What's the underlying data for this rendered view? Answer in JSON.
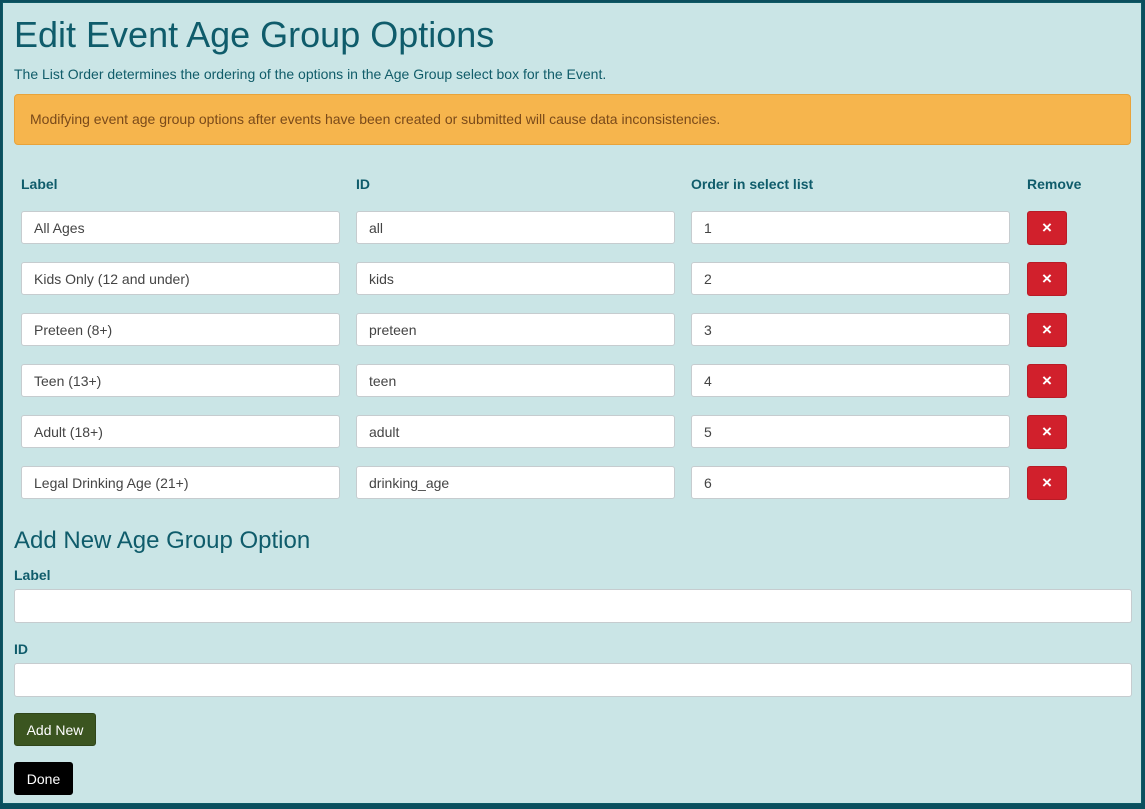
{
  "page": {
    "title": "Edit Event Age Group Options",
    "description": "The List Order determines the ordering of the options in the Age Group select box for the Event.",
    "alert": "Modifying event age group options after events have been created or submitted will cause data inconsistencies."
  },
  "table": {
    "headers": [
      "Label",
      "ID",
      "Order in select list",
      "Remove"
    ],
    "rows": [
      {
        "label": "All Ages",
        "id": "all",
        "order": "1"
      },
      {
        "label": "Kids Only (12 and under)",
        "id": "kids",
        "order": "2"
      },
      {
        "label": "Preteen (8+)",
        "id": "preteen",
        "order": "3"
      },
      {
        "label": "Teen (13+)",
        "id": "teen",
        "order": "4"
      },
      {
        "label": "Adult (18+)",
        "id": "adult",
        "order": "5"
      },
      {
        "label": "Legal Drinking Age (21+)",
        "id": "drinking_age",
        "order": "6"
      }
    ],
    "remove_icon": "×"
  },
  "add_new": {
    "title": "Add New Age Group Option",
    "label_label": "Label",
    "label_value": "",
    "id_label": "ID",
    "id_value": "",
    "add_button": "Add New",
    "done_button": "Done"
  },
  "colors": {
    "background": "#cae5e6",
    "heading": "#0f5c6b",
    "alert": "#f6b54d",
    "remove": "#d1202c",
    "add": "#3b5520"
  }
}
